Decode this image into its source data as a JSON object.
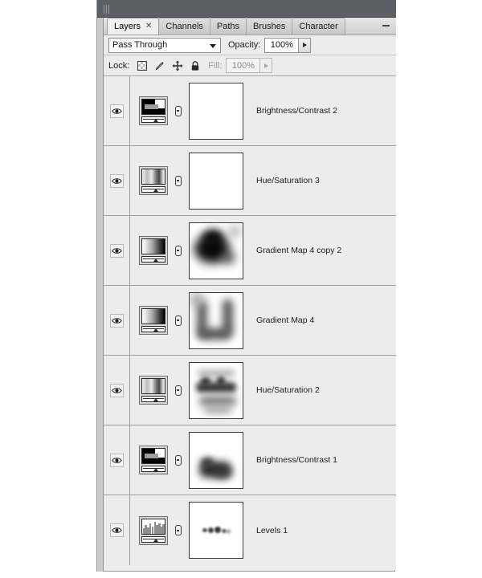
{
  "app": {
    "panel_title": "Layers",
    "window_kind": "photoshop-layers-panel"
  },
  "tabs": [
    {
      "label": "Layers",
      "active": true,
      "closable": true,
      "close_glyph": "✕"
    },
    {
      "label": "Channels",
      "active": false,
      "closable": false,
      "close_glyph": ""
    },
    {
      "label": "Paths",
      "active": false,
      "closable": false,
      "close_glyph": ""
    },
    {
      "label": "Brushes",
      "active": false,
      "closable": false,
      "close_glyph": ""
    },
    {
      "label": "Character",
      "active": false,
      "closable": false,
      "close_glyph": ""
    }
  ],
  "controls": {
    "blend_mode": "Pass Through",
    "opacity_label": "Opacity:",
    "opacity_value": "100%",
    "lock_label": "Lock:",
    "fill_label": "Fill:",
    "fill_value": "100%",
    "lock_buttons": [
      {
        "name": "lock-transparent-pixels",
        "title": "Lock transparent pixels"
      },
      {
        "name": "lock-image-pixels",
        "title": "Lock image pixels"
      },
      {
        "name": "lock-position",
        "title": "Lock position"
      },
      {
        "name": "lock-all",
        "title": "Lock all"
      }
    ]
  },
  "layers": [
    {
      "name": "Brightness/Contrast 2",
      "kind": "brightness-contrast",
      "visible": true,
      "linked": true,
      "mask": "empty"
    },
    {
      "name": "Hue/Saturation 3",
      "kind": "hue-saturation",
      "visible": true,
      "linked": true,
      "mask": "empty"
    },
    {
      "name": "Gradient Map 4 copy 2",
      "kind": "gradient-map",
      "visible": true,
      "linked": true,
      "mask": "dark-center-blob"
    },
    {
      "name": "Gradient Map 4",
      "kind": "gradient-map",
      "visible": true,
      "linked": true,
      "mask": "u-shape"
    },
    {
      "name": "Hue/Saturation 2",
      "kind": "hue-saturation",
      "visible": true,
      "linked": true,
      "mask": "mid-band-reflection"
    },
    {
      "name": "Brightness/Contrast 1",
      "kind": "brightness-contrast",
      "visible": true,
      "linked": true,
      "mask": "small-lower-blob"
    },
    {
      "name": "Levels 1",
      "kind": "levels",
      "visible": true,
      "linked": true,
      "mask": "faint-speckles"
    }
  ],
  "colors": {
    "panel_bg": "#ececec",
    "dock_bar": "#5c6066",
    "row_divider": "#9e9e9e",
    "text": "#1a1a1a"
  }
}
